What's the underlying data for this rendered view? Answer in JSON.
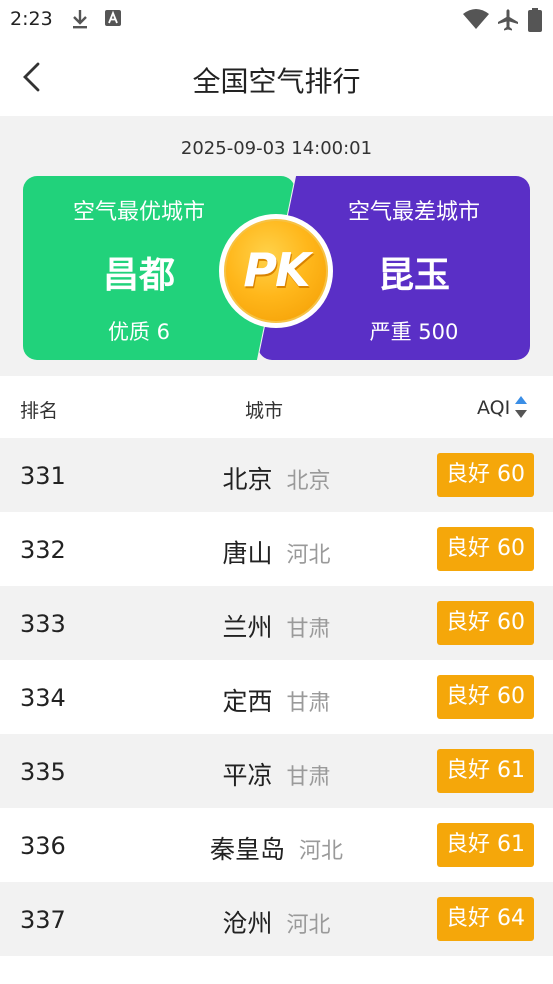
{
  "status_bar": {
    "time": "2:23"
  },
  "header": {
    "title": "全国空气排行"
  },
  "hero": {
    "timestamp": "2025-09-03 14:00:01",
    "best": {
      "label": "空气最优城市",
      "city": "昌都",
      "level": "优质 6"
    },
    "worst": {
      "label": "空气最差城市",
      "city": "昆玉",
      "level": "严重 500"
    },
    "pk_label": "PK"
  },
  "table": {
    "col_rank": "排名",
    "col_city": "城市",
    "col_aqi": "AQI",
    "rows": [
      {
        "rank": "331",
        "city": "北京",
        "province": "北京",
        "aqi": "良好 60"
      },
      {
        "rank": "332",
        "city": "唐山",
        "province": "河北",
        "aqi": "良好 60"
      },
      {
        "rank": "333",
        "city": "兰州",
        "province": "甘肃",
        "aqi": "良好 60"
      },
      {
        "rank": "334",
        "city": "定西",
        "province": "甘肃",
        "aqi": "良好 60"
      },
      {
        "rank": "335",
        "city": "平凉",
        "province": "甘肃",
        "aqi": "良好 61"
      },
      {
        "rank": "336",
        "city": "秦皇岛",
        "province": "河北",
        "aqi": "良好 61"
      },
      {
        "rank": "337",
        "city": "沧州",
        "province": "河北",
        "aqi": "良好 64"
      }
    ]
  },
  "colors": {
    "best_card": "#21d27b",
    "worst_card": "#5a2fc6",
    "aqi_badge_good": "#f5a70a",
    "sort_active": "#3a8ee6"
  },
  "icons": [
    "download-icon",
    "a-letter-icon",
    "wifi-icon",
    "airplane-mode-icon",
    "battery-icon",
    "back-arrow-icon",
    "pk-badge-icon",
    "sort-icon"
  ]
}
